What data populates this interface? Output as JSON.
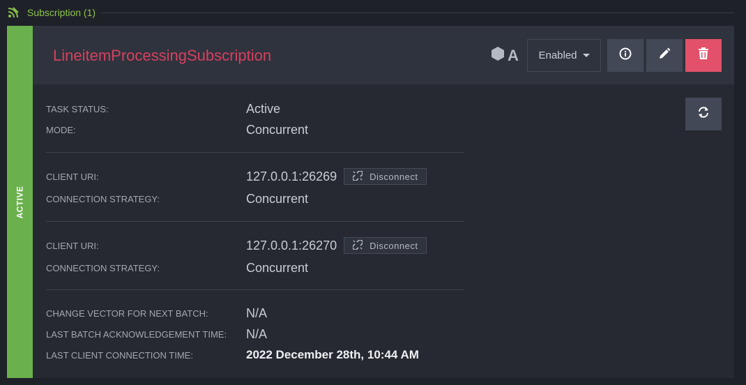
{
  "section": {
    "title": "Subscription (1)"
  },
  "card": {
    "status": "ACTIVE",
    "name": "LineitemProcessingSubscription",
    "node_tag": "A",
    "state_dropdown": "Enabled",
    "task": {
      "status_label": "TASK STATUS:",
      "status_value": "Active",
      "mode_label": "MODE:",
      "mode_value": "Concurrent"
    },
    "clients": [
      {
        "uri_label": "CLIENT URI:",
        "uri": "127.0.0.1:26269",
        "disconnect_label": "Disconnect",
        "strategy_label": "CONNECTION STRATEGY:",
        "strategy": "Concurrent"
      },
      {
        "uri_label": "CLIENT URI:",
        "uri": "127.0.0.1:26270",
        "disconnect_label": "Disconnect",
        "strategy_label": "CONNECTION STRATEGY:",
        "strategy": "Concurrent"
      }
    ],
    "batch": {
      "cv_label": "CHANGE VECTOR FOR NEXT BATCH:",
      "cv_value": "N/A",
      "ack_label": "LAST BATCH ACKNOWLEDGEMENT TIME:",
      "ack_value": "N/A",
      "conn_label": "LAST CLIENT CONNECTION TIME:",
      "conn_value": "2022 December 28th, 10:44 AM"
    }
  },
  "icons": {
    "section": "subscription-feed-icon",
    "node": "hexagon-icon",
    "info": "info-icon",
    "edit": "pencil-icon",
    "delete": "trash-icon",
    "refresh": "refresh-icon",
    "disconnect": "broken-link-icon",
    "dropdown": "caret-down-icon"
  },
  "colors": {
    "background": "#1f2129",
    "card": "#262931",
    "card_header": "#2f333d",
    "accent_green": "#8bc34a",
    "status_strip": "#6ab04c",
    "name_pink": "#d7405f",
    "delete_red": "#e25169",
    "button_gray": "#434857"
  }
}
